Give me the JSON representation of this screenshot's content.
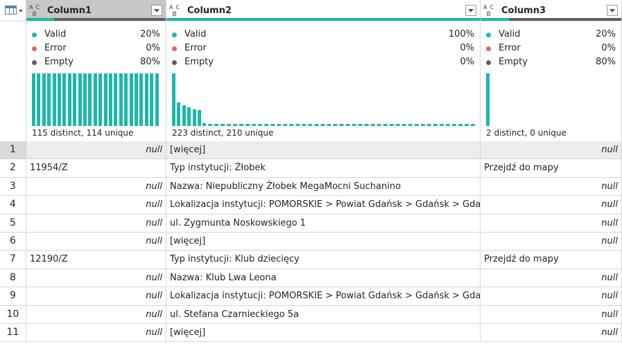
{
  "columns": [
    {
      "title": "Column1",
      "type_icon": "text-type-icon",
      "valid_fraction": 0.2
    },
    {
      "title": "Column2",
      "type_icon": "text-type-icon",
      "valid_fraction": 1.0
    },
    {
      "title": "Column3",
      "type_icon": "text-type-icon",
      "valid_fraction": 0.2
    }
  ],
  "profile": [
    {
      "valid_label": "Valid",
      "valid_pct": "20%",
      "error_label": "Error",
      "error_pct": "0%",
      "empty_label": "Empty",
      "empty_pct": "80%",
      "summary": "115 distinct, 114 unique"
    },
    {
      "valid_label": "Valid",
      "valid_pct": "100%",
      "error_label": "Error",
      "error_pct": "0%",
      "empty_label": "Empty",
      "empty_pct": "0%",
      "summary": "223 distinct, 210 unique"
    },
    {
      "valid_label": "Valid",
      "valid_pct": "20%",
      "error_label": "Error",
      "error_pct": "0%",
      "empty_label": "Empty",
      "empty_pct": "80%",
      "summary": "2 distinct, 0 unique"
    }
  ],
  "histograms": [
    {
      "bar_levels": [
        1,
        1,
        1,
        1,
        1,
        1,
        1,
        1,
        1,
        1,
        1,
        1,
        1,
        1,
        1,
        1,
        1,
        1,
        1,
        1,
        1,
        1,
        1,
        1,
        1
      ],
      "dashed_tail": false
    },
    {
      "bar_levels": [
        1,
        0.45,
        0.4,
        0.35,
        0.32,
        0.3,
        0.05
      ],
      "dashed_tail": true
    },
    {
      "bar_levels": [
        1
      ],
      "dashed_tail": false
    }
  ],
  "colors": {
    "valid": "#1cb8aa",
    "error": "#e8625e",
    "empty": "#5f5f5f"
  },
  "rows": [
    {
      "num": "1",
      "c1": "null",
      "c2": "[więcej]",
      "c3": "null"
    },
    {
      "num": "2",
      "c1": "11954/Z",
      "c2": "Typ instytucji: Żłobek",
      "c3": "Przejdź do mapy"
    },
    {
      "num": "3",
      "c1": "null",
      "c2": "Nazwa: Niepubliczny Żłobek MegaMocni Suchanino",
      "c3": "null"
    },
    {
      "num": "4",
      "c1": "null",
      "c2": "Lokalizacja instytucji: POMORSKIE > Powiat Gdańsk > Gdańsk > Gdańsk",
      "c3": "null"
    },
    {
      "num": "5",
      "c1": "null",
      "c2": "ul. Zygmunta Noskowskiego 1",
      "c3": "null"
    },
    {
      "num": "6",
      "c1": "null",
      "c2": "[więcej]",
      "c3": "null"
    },
    {
      "num": "7",
      "c1": "12190/Z",
      "c2": "Typ instytucji: Klub dziecięcy",
      "c3": "Przejdź do mapy"
    },
    {
      "num": "8",
      "c1": "null",
      "c2": "Nazwa: Klub Lwa Leona",
      "c3": "null"
    },
    {
      "num": "9",
      "c1": "null",
      "c2": "Lokalizacja instytucji: POMORSKIE > Powiat Gdańsk > Gdańsk > Gdańsk",
      "c3": "null"
    },
    {
      "num": "10",
      "c1": "null",
      "c2": "ul. Stefana Czarnieckiego 5a",
      "c3": "null"
    },
    {
      "num": "11",
      "c1": "null",
      "c2": "[więcej]",
      "c3": "null"
    }
  ]
}
